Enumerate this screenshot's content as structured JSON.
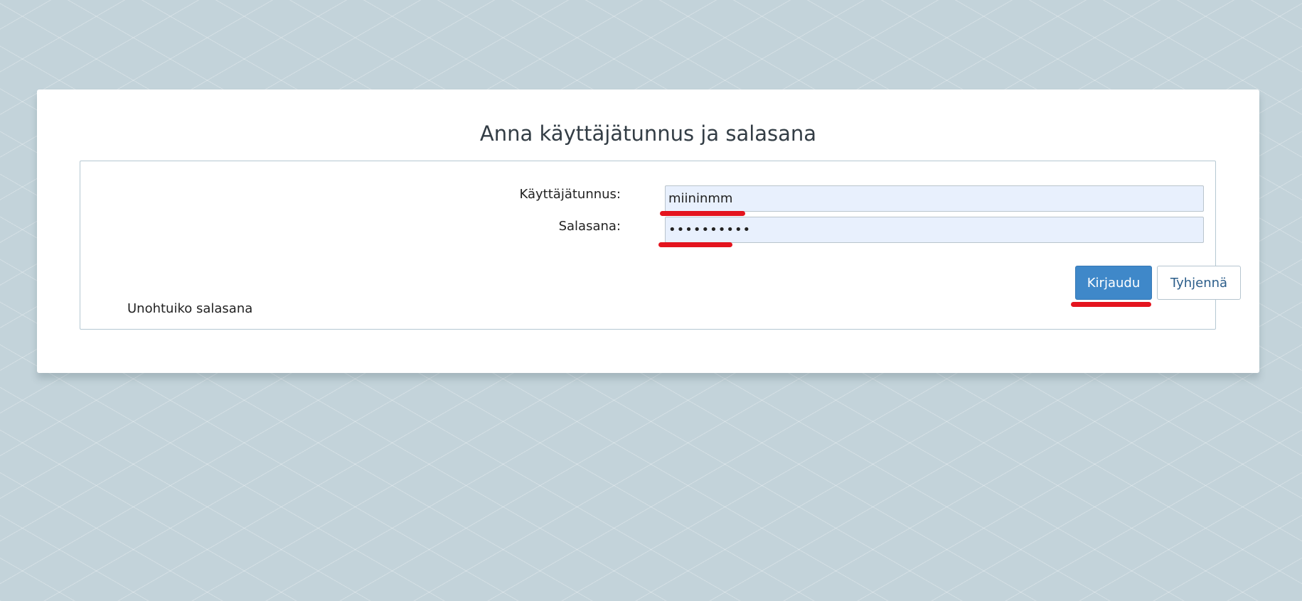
{
  "login": {
    "title": "Anna käyttäjätunnus ja salasana",
    "username_label": "Käyttäjätunnus:",
    "username_value": "miininmm",
    "password_label": "Salasana:",
    "password_value": "••••••••••",
    "login_button": "Kirjaudu",
    "clear_button": "Tyhjennä",
    "forgot_link": "Unohtuiko salasana"
  },
  "colors": {
    "background": "#c3d3da",
    "primary_button": "#3f88c9",
    "field_background": "#e8f0fd",
    "annotation_underline": "#e2000b"
  }
}
